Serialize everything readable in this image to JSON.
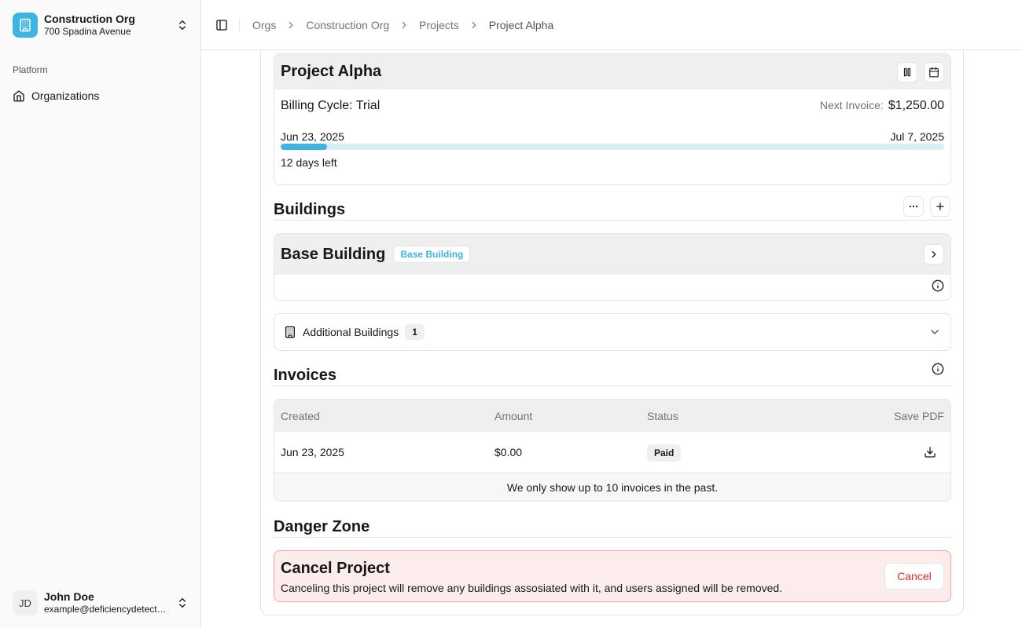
{
  "sidebar": {
    "org": {
      "name": "Construction Org",
      "address": "700 Spadina Avenue",
      "logo_color": "#3db5e2"
    },
    "group_label": "Platform",
    "items": [
      {
        "label": "Organizations",
        "icon": "home-icon"
      }
    ],
    "user": {
      "initials": "JD",
      "name": "John Doe",
      "email": "example@deficiencydetect...."
    }
  },
  "breadcrumb": [
    "Orgs",
    "Construction Org",
    "Projects",
    "Project Alpha"
  ],
  "project": {
    "title": "Project Alpha",
    "billing_cycle": "Billing Cycle: Trial",
    "next_invoice_label": "Next Invoice:",
    "next_invoice_amount": "$1,250.00",
    "start_date": "Jun 23, 2025",
    "end_date": "Jul 7, 2025",
    "progress_fraction": 0.07,
    "days_left": "12 days left"
  },
  "buildings": {
    "title": "Buildings",
    "base": {
      "name": "Base Building",
      "badge": "Base Building"
    },
    "additional": {
      "label": "Additional Buildings",
      "count": "1"
    }
  },
  "invoices": {
    "title": "Invoices",
    "columns": {
      "created": "Created",
      "amount": "Amount",
      "status": "Status",
      "pdf": "Save PDF"
    },
    "rows": [
      {
        "created": "Jun 23, 2025",
        "amount": "$0.00",
        "status": "Paid"
      }
    ],
    "footer": "We only show up to 10 invoices in the past."
  },
  "danger": {
    "title": "Danger Zone",
    "card_title": "Cancel Project",
    "description": "Canceling this project will remove any buildings assosiated with it, and users assigned will be removed.",
    "button": "Cancel"
  },
  "colors": {
    "accent": "#3db5e2",
    "danger": "#dc2626",
    "danger_bg": "#fdecec"
  }
}
